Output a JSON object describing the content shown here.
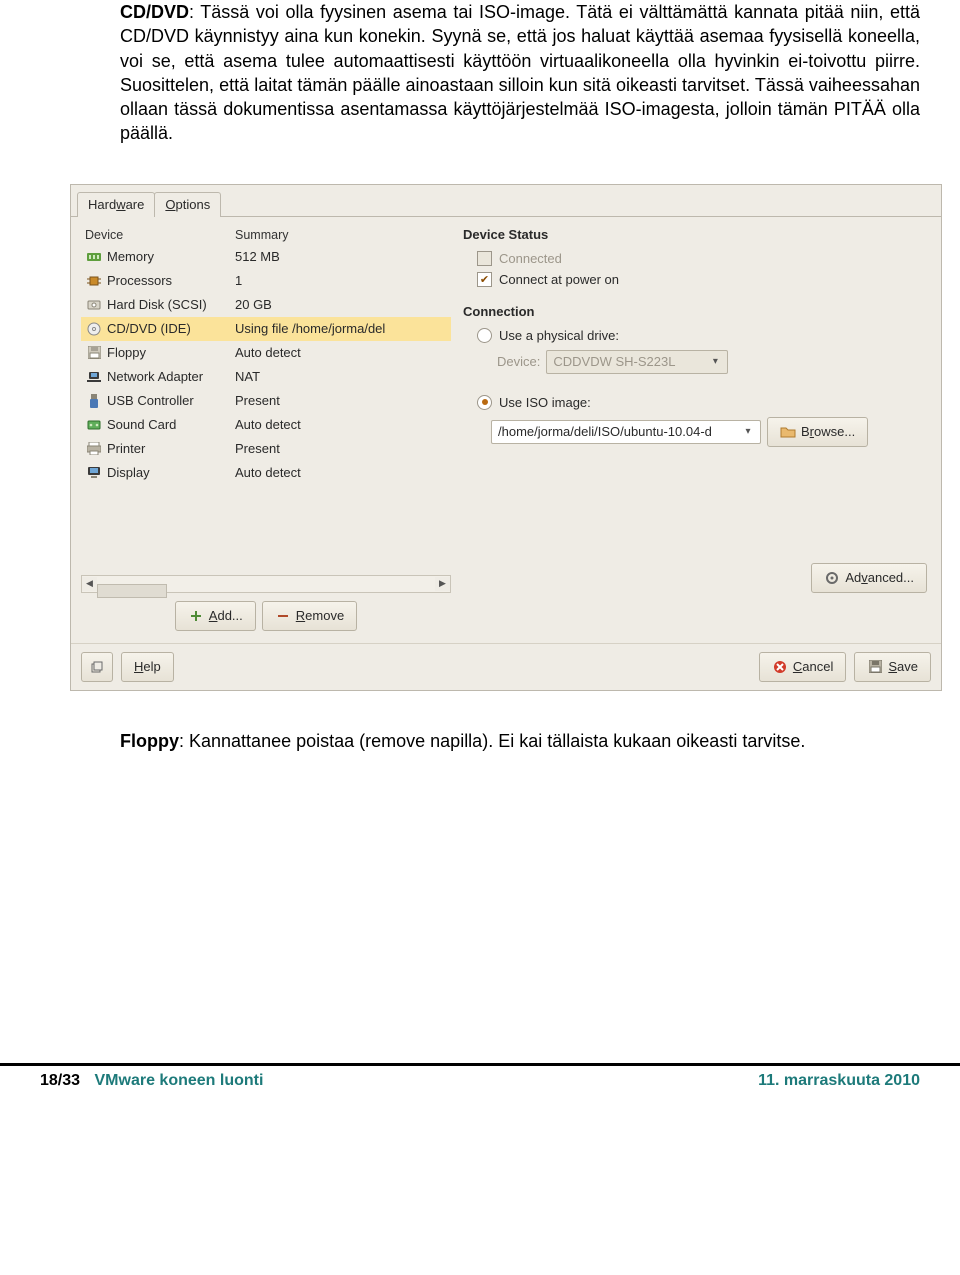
{
  "doc": {
    "p1_lead": "CD/DVD",
    "p1_rest": ": Tässä voi olla fyysinen asema tai ISO-image. Tätä ei välttämättä kannata pitää niin, että CD/DVD käynnistyy aina kun konekin. Syynä se, että jos haluat käyttää asemaa fyysisellä koneella, voi se, että asema tulee automaattisesti käyttöön virtuaalikoneella olla hyvinkin ei-toivottu piirre. Suosittelen, että laitat tämän päälle ainoastaan silloin kun sitä oikeasti tarvitset. Tässä vaiheessahan ollaan tässä dokumentissa asentamassa käyttöjärjestelmää ISO-imagesta, jolloin tämän PITÄÄ olla päällä.",
    "p2_lead": "Floppy",
    "p2_rest": ": Kannattanee poistaa (remove napilla). Ei kai tällaista kukaan oikeasti tarvitse."
  },
  "tabs": {
    "hardware": "Hardware",
    "options": "Options"
  },
  "table": {
    "head_device": "Device",
    "head_summary": "Summary",
    "rows": [
      {
        "name": "Memory",
        "summary": "512 MB"
      },
      {
        "name": "Processors",
        "summary": "1"
      },
      {
        "name": "Hard Disk (SCSI)",
        "summary": "20 GB"
      },
      {
        "name": "CD/DVD (IDE)",
        "summary": "Using file /home/jorma/del"
      },
      {
        "name": "Floppy",
        "summary": "Auto detect"
      },
      {
        "name": "Network Adapter",
        "summary": "NAT"
      },
      {
        "name": "USB Controller",
        "summary": "Present"
      },
      {
        "name": "Sound Card",
        "summary": "Auto detect"
      },
      {
        "name": "Printer",
        "summary": "Present"
      },
      {
        "name": "Display",
        "summary": "Auto detect"
      }
    ]
  },
  "buttons": {
    "add": "Add...",
    "remove": "Remove",
    "advanced": "Advanced...",
    "help": "Help",
    "cancel": "Cancel",
    "save": "Save",
    "browse": "Browse..."
  },
  "status": {
    "title": "Device Status",
    "connected": "Connected",
    "connect_power": "Connect at power on"
  },
  "conn": {
    "title": "Connection",
    "physical": "Use a physical drive:",
    "device_label": "Device:",
    "device_value": "CDDVDW SH-S223L",
    "iso": "Use ISO image:",
    "iso_path": "/home/jorma/deli/ISO/ubuntu-10.04-d"
  },
  "footer": {
    "page": "18/33",
    "title": "VMware koneen luonti",
    "date": "11. marraskuuta 2010"
  }
}
